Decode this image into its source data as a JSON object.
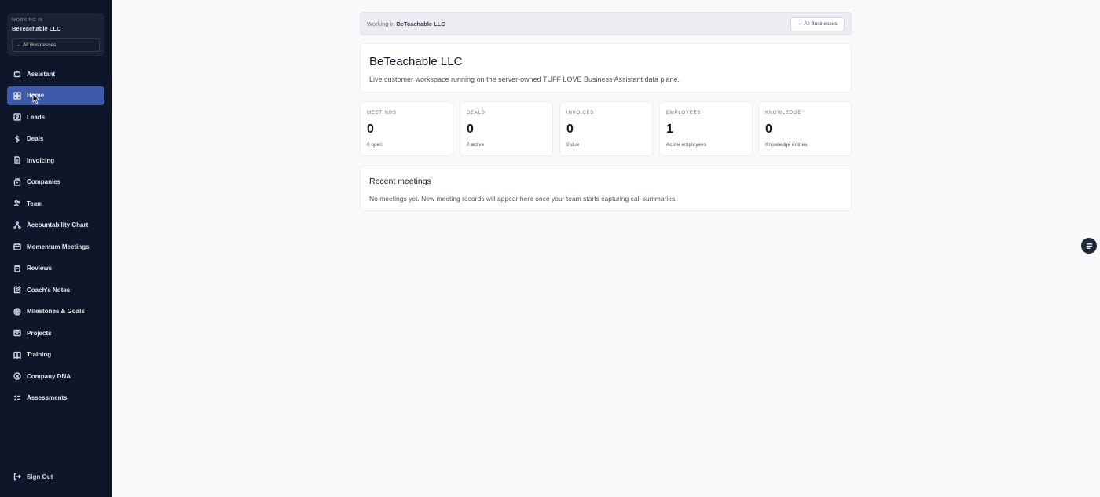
{
  "sidebar": {
    "workspace_label": "WORKING IN",
    "workspace_name": "BeTeachable LLC",
    "all_businesses": "← All Businesses",
    "items": [
      {
        "label": "Assistant",
        "icon": "bot-icon"
      },
      {
        "label": "Home",
        "icon": "grid-icon",
        "active": true
      },
      {
        "label": "Leads",
        "icon": "contact-icon"
      },
      {
        "label": "Deals",
        "icon": "dollar-icon"
      },
      {
        "label": "Invoicing",
        "icon": "file-icon"
      },
      {
        "label": "Companies",
        "icon": "building-icon"
      },
      {
        "label": "Team",
        "icon": "users-icon"
      },
      {
        "label": "Accountability Chart",
        "icon": "network-icon"
      },
      {
        "label": "Momentum Meetings",
        "icon": "calendar-icon"
      },
      {
        "label": "Reviews",
        "icon": "clipboard-icon"
      },
      {
        "label": "Coach's Notes",
        "icon": "edit-icon"
      },
      {
        "label": "Milestones & Goals",
        "icon": "target-icon"
      },
      {
        "label": "Projects",
        "icon": "folder-icon"
      },
      {
        "label": "Training",
        "icon": "book-icon"
      },
      {
        "label": "Company DNA",
        "icon": "dna-icon"
      },
      {
        "label": "Assessments",
        "icon": "list-check-icon"
      }
    ],
    "sign_out": "Sign Out"
  },
  "banner": {
    "prefix": "Working in",
    "business": "BeTeachable LLC",
    "button": "← All Businesses"
  },
  "header": {
    "title": "BeTeachable LLC",
    "subtitle": "Live customer workspace running on the server-owned TUFF LOVE Business Assistant data plane."
  },
  "stats": [
    {
      "label": "MEETINGS",
      "value": "0",
      "sub": "0 open"
    },
    {
      "label": "DEALS",
      "value": "0",
      "sub": "0 active"
    },
    {
      "label": "INVOICES",
      "value": "0",
      "sub": "0 due"
    },
    {
      "label": "EMPLOYEES",
      "value": "1",
      "sub": "Active employees"
    },
    {
      "label": "KNOWLEDGE",
      "value": "0",
      "sub": "Knowledge entries"
    }
  ],
  "recent": {
    "title": "Recent meetings",
    "empty": "No meetings yet. New meeting records will appear here once your team starts capturing call summaries."
  },
  "colors": {
    "sidebar_bg": "#0e1729",
    "active_item": "#3d5ba8",
    "page_bg": "#f9f9fb"
  }
}
